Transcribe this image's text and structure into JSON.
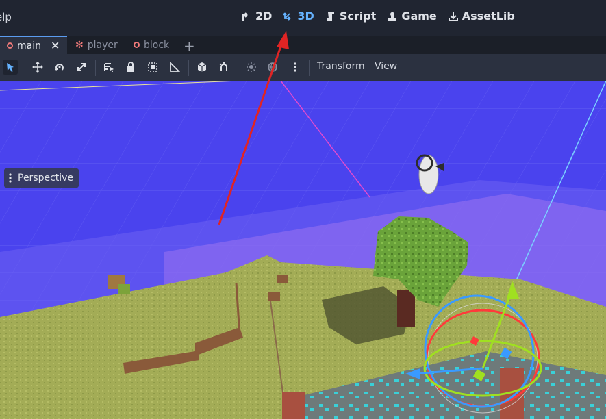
{
  "menu": {
    "help_partial": "elp"
  },
  "modes": [
    {
      "label": "2D",
      "icon": "2d-icon"
    },
    {
      "label": "3D",
      "icon": "3d-icon"
    },
    {
      "label": "Script",
      "icon": "script-icon"
    },
    {
      "label": "Game",
      "icon": "game-icon"
    },
    {
      "label": "AssetLib",
      "icon": "assetlib-icon"
    }
  ],
  "tabs": [
    {
      "label": "main"
    },
    {
      "label": "player"
    },
    {
      "label": "block"
    }
  ],
  "toolbar": {
    "transform_label": "Transform",
    "view_label": "View"
  },
  "viewport": {
    "perspective_label": "Perspective"
  },
  "colors": {
    "accent": "#66b3ff",
    "sky": "#4a43ee",
    "grass": "#a3ac56",
    "annotation_arrow": "#e02424"
  }
}
